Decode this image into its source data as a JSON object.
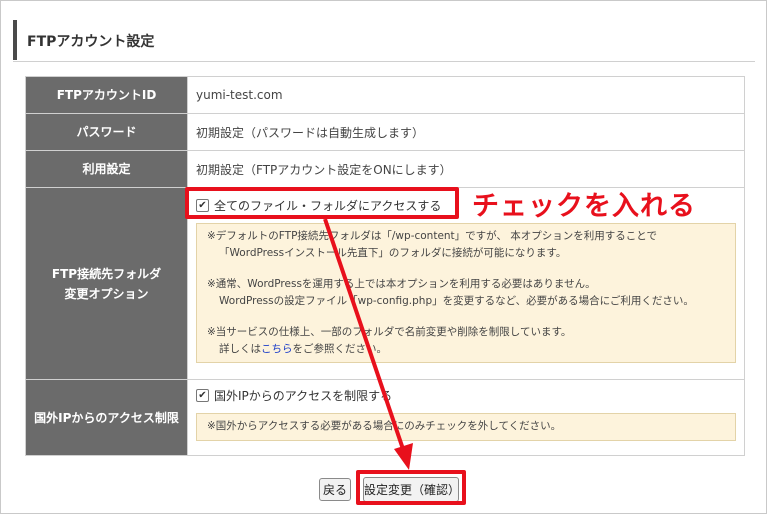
{
  "header": {
    "title": "FTPアカウント設定"
  },
  "rows": [
    {
      "label": "FTPアカウントID",
      "value": "yumi-test.com"
    },
    {
      "label": "パスワード",
      "value": "初期設定（パスワードは自動生成します）"
    },
    {
      "label": "利用設定",
      "value": "初期設定（FTPアカウント設定をONにします）"
    }
  ],
  "folder_option": {
    "label_line1": "FTP接続先フォルダ",
    "label_line2": "変更オプション",
    "checkbox_label": "全てのファイル・フォルダにアクセスする",
    "checked": true,
    "note_lines_1": [
      "※デフォルトのFTP接続先フォルダは「/wp-content」ですが、 本オプションを利用することで",
      "「WordPressインストール先直下」のフォルダに接続が可能になります。"
    ],
    "note_lines_2": [
      "※通常、WordPressを運用する上では本オプションを利用する必要はありません。",
      "WordPressの設定ファイル「wp-config.php」を変更するなど、必要がある場合にご利用ください。"
    ],
    "note_line_3": "※当サービスの仕様上、一部のフォルダで名前変更や削除を制限しています。",
    "note_line_4_prefix": "詳しくは",
    "note_link": "こちら",
    "note_line_4_suffix": "をご参照ください。"
  },
  "foreign_ip": {
    "label": "国外IPからのアクセス制限",
    "checkbox_label": "国外IPからのアクセスを制限する",
    "checked": true,
    "note": "※国外からアクセスする必要がある場合にのみチェックを外してください。"
  },
  "buttons": {
    "back": "戻る",
    "confirm": "設定変更（確認）"
  },
  "annotation": {
    "callout": "チェックを入れる",
    "accent_color": "#e8101c"
  }
}
